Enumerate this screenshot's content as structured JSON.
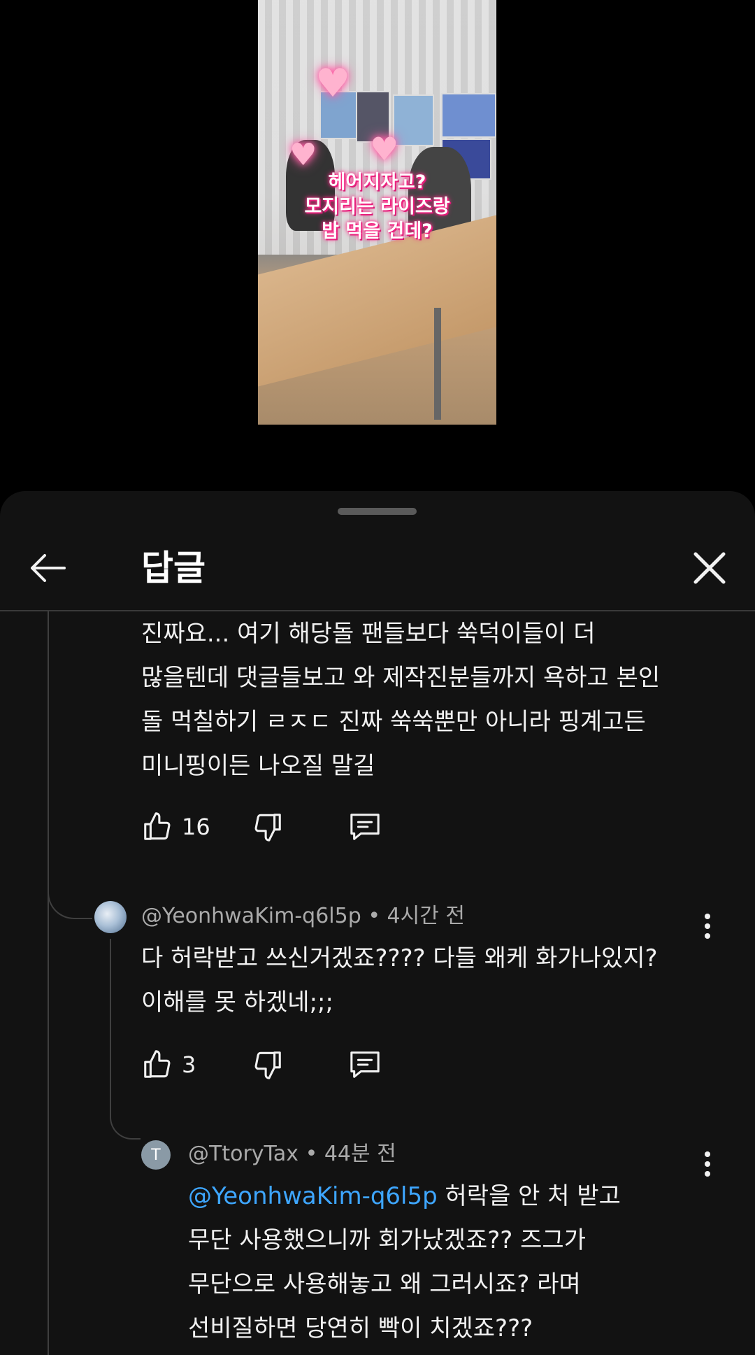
{
  "video": {
    "caption_lines": [
      "헤어지자고?",
      "모지리는 라이즈랑",
      "밥 먹을 건데?"
    ]
  },
  "sheet": {
    "title": "답글"
  },
  "comment_parent": {
    "lines": [
      "진짜요... 여기 해당돌 팬들보다 쑥덕이들이 더",
      "많을텐데 댓글들보고 와 제작진분들까지 욕하고 본인",
      "돌 먹칠하기 ㄹㅈㄷ 진짜 쑥쑥뿐만 아니라 핑계고든",
      "미니핑이든 나오질 말길"
    ],
    "likes": "16"
  },
  "reply1": {
    "author": "@YeonhwaKim-q6l5p",
    "time": "4시간 전",
    "lines": [
      "다 허락받고 쓰신거겠죠???? 다들 왜케 화가나있지?",
      "이해를 못 하겠네;;;"
    ],
    "likes": "3"
  },
  "reply2": {
    "avatar_letter": "T",
    "author": "@TtoryTax",
    "time": "44분 전",
    "mention": "@YeonhwaKim-q6l5p",
    "first_line_rest": "허락을 안 처 받고",
    "lines": [
      "무단 사용했으니까 회가났겠죠?? 즈그가",
      "무단으로 사용해놓고 왜 그러시죠? 라며",
      "선비질하면 당연히 빡이 치겠죠???"
    ]
  },
  "colors": {
    "background": "#000000",
    "sheet": "#121212",
    "text": "#f1f1f1",
    "secondary_text": "#aaaaaa",
    "mention": "#3ea6ff"
  },
  "icons": [
    "back-arrow-icon",
    "close-icon",
    "thumb-up-icon",
    "thumb-down-icon",
    "reply-icon",
    "more-vert-icon"
  ]
}
